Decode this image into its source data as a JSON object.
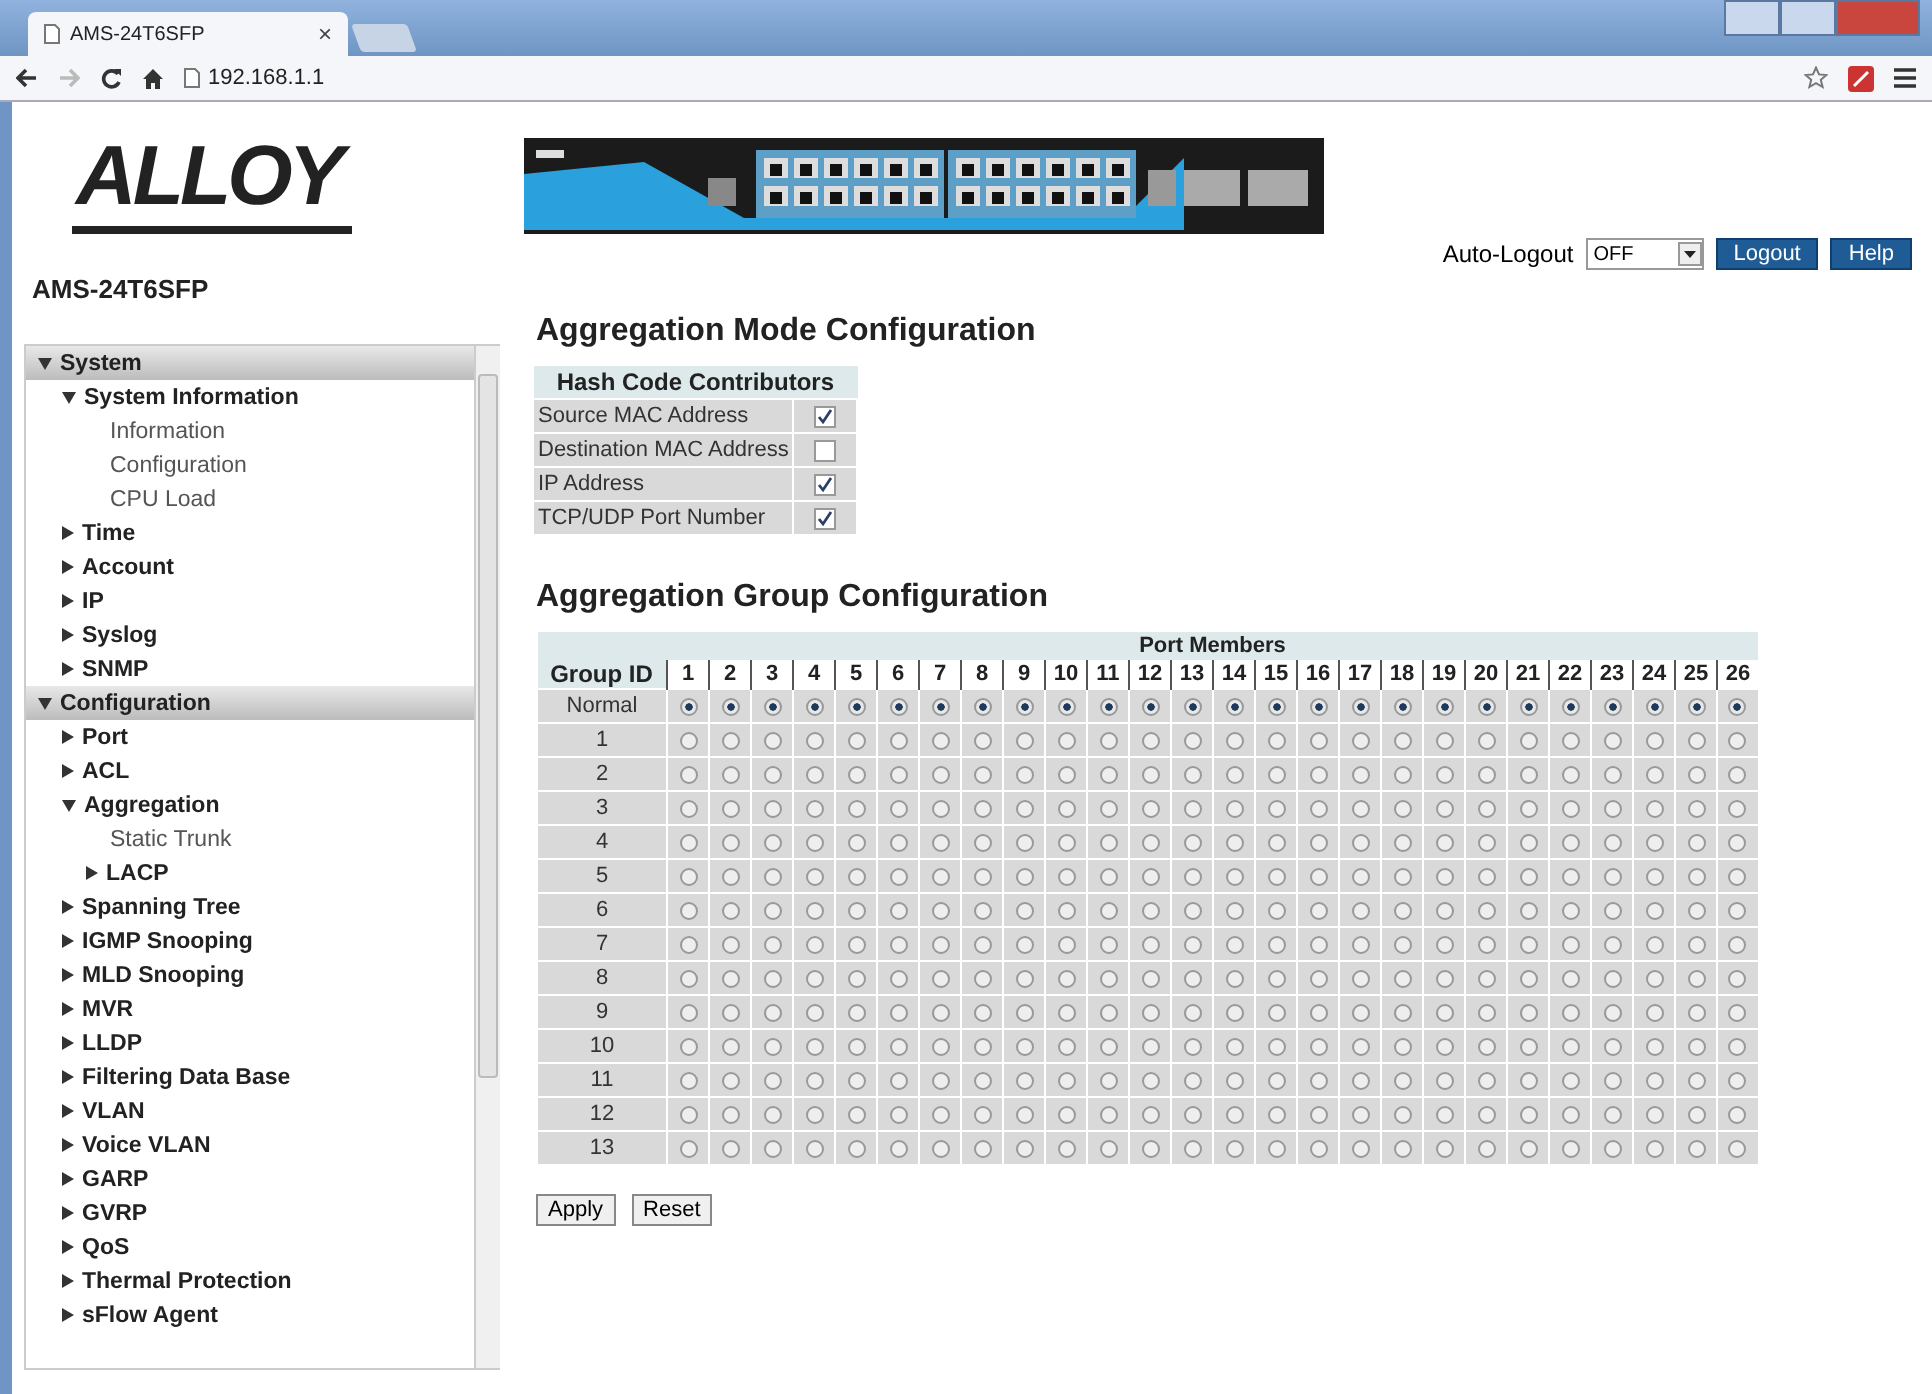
{
  "browser": {
    "tab_title": "AMS-24T6SFP",
    "tab_close": "×",
    "address": "192.168.1.1"
  },
  "brand": {
    "logo": "ALLOY",
    "model": "AMS-24T6SFP"
  },
  "sidebar": {
    "items": [
      {
        "label": "System",
        "kind": "folder",
        "expanded": true,
        "children": [
          {
            "label": "System Information",
            "kind": "folder",
            "expanded": true,
            "children": [
              {
                "label": "Information",
                "kind": "page"
              },
              {
                "label": "Configuration",
                "kind": "page"
              },
              {
                "label": "CPU Load",
                "kind": "page"
              }
            ]
          },
          {
            "label": "Time",
            "kind": "folder",
            "expanded": false
          },
          {
            "label": "Account",
            "kind": "folder",
            "expanded": false
          },
          {
            "label": "IP",
            "kind": "folder",
            "expanded": false
          },
          {
            "label": "Syslog",
            "kind": "folder",
            "expanded": false
          },
          {
            "label": "SNMP",
            "kind": "folder",
            "expanded": false
          }
        ]
      },
      {
        "label": "Configuration",
        "kind": "folder",
        "expanded": true,
        "children": [
          {
            "label": "Port",
            "kind": "folder",
            "expanded": false
          },
          {
            "label": "ACL",
            "kind": "folder",
            "expanded": false
          },
          {
            "label": "Aggregation",
            "kind": "folder",
            "expanded": true,
            "children": [
              {
                "label": "Static Trunk",
                "kind": "page"
              },
              {
                "label": "LACP",
                "kind": "folder",
                "expanded": false
              }
            ]
          },
          {
            "label": "Spanning Tree",
            "kind": "folder",
            "expanded": false
          },
          {
            "label": "IGMP Snooping",
            "kind": "folder",
            "expanded": false
          },
          {
            "label": "MLD Snooping",
            "kind": "folder",
            "expanded": false
          },
          {
            "label": "MVR",
            "kind": "folder",
            "expanded": false
          },
          {
            "label": "LLDP",
            "kind": "folder",
            "expanded": false
          },
          {
            "label": "Filtering Data Base",
            "kind": "folder",
            "expanded": false
          },
          {
            "label": "VLAN",
            "kind": "folder",
            "expanded": false
          },
          {
            "label": "Voice VLAN",
            "kind": "folder",
            "expanded": false
          },
          {
            "label": "GARP",
            "kind": "folder",
            "expanded": false
          },
          {
            "label": "GVRP",
            "kind": "folder",
            "expanded": false
          },
          {
            "label": "QoS",
            "kind": "folder",
            "expanded": false
          },
          {
            "label": "Thermal Protection",
            "kind": "folder",
            "expanded": false
          },
          {
            "label": "sFlow Agent",
            "kind": "folder",
            "expanded": false
          }
        ]
      }
    ]
  },
  "toolbar": {
    "auto_logout_label": "Auto-Logout",
    "auto_logout_value": "OFF",
    "buttons": [
      "Logout",
      "Help"
    ]
  },
  "mode": {
    "title": "Aggregation Mode Configuration",
    "table_header": "Hash Code Contributors",
    "rows": [
      {
        "label": "Source MAC Address",
        "checked": true
      },
      {
        "label": "Destination MAC Address",
        "checked": false
      },
      {
        "label": "IP Address",
        "checked": true
      },
      {
        "label": "TCP/UDP Port Number",
        "checked": true
      }
    ]
  },
  "groups": {
    "title": "Aggregation Group Configuration",
    "group_header": "Group ID",
    "members_header": "Port Members",
    "ports": [
      "1",
      "2",
      "3",
      "4",
      "5",
      "6",
      "7",
      "8",
      "9",
      "10",
      "11",
      "12",
      "13",
      "14",
      "15",
      "16",
      "17",
      "18",
      "19",
      "20",
      "21",
      "22",
      "23",
      "24",
      "25",
      "26"
    ],
    "rows": [
      {
        "group": "Normal",
        "selected": [
          true,
          true,
          true,
          true,
          true,
          true,
          true,
          true,
          true,
          true,
          true,
          true,
          true,
          true,
          true,
          true,
          true,
          true,
          true,
          true,
          true,
          true,
          true,
          true,
          true,
          true
        ]
      },
      {
        "group": "1",
        "selected": [
          false,
          false,
          false,
          false,
          false,
          false,
          false,
          false,
          false,
          false,
          false,
          false,
          false,
          false,
          false,
          false,
          false,
          false,
          false,
          false,
          false,
          false,
          false,
          false,
          false,
          false
        ]
      },
      {
        "group": "2",
        "selected": [
          false,
          false,
          false,
          false,
          false,
          false,
          false,
          false,
          false,
          false,
          false,
          false,
          false,
          false,
          false,
          false,
          false,
          false,
          false,
          false,
          false,
          false,
          false,
          false,
          false,
          false
        ]
      },
      {
        "group": "3",
        "selected": [
          false,
          false,
          false,
          false,
          false,
          false,
          false,
          false,
          false,
          false,
          false,
          false,
          false,
          false,
          false,
          false,
          false,
          false,
          false,
          false,
          false,
          false,
          false,
          false,
          false,
          false
        ]
      },
      {
        "group": "4",
        "selected": [
          false,
          false,
          false,
          false,
          false,
          false,
          false,
          false,
          false,
          false,
          false,
          false,
          false,
          false,
          false,
          false,
          false,
          false,
          false,
          false,
          false,
          false,
          false,
          false,
          false,
          false
        ]
      },
      {
        "group": "5",
        "selected": [
          false,
          false,
          false,
          false,
          false,
          false,
          false,
          false,
          false,
          false,
          false,
          false,
          false,
          false,
          false,
          false,
          false,
          false,
          false,
          false,
          false,
          false,
          false,
          false,
          false,
          false
        ]
      },
      {
        "group": "6",
        "selected": [
          false,
          false,
          false,
          false,
          false,
          false,
          false,
          false,
          false,
          false,
          false,
          false,
          false,
          false,
          false,
          false,
          false,
          false,
          false,
          false,
          false,
          false,
          false,
          false,
          false,
          false
        ]
      },
      {
        "group": "7",
        "selected": [
          false,
          false,
          false,
          false,
          false,
          false,
          false,
          false,
          false,
          false,
          false,
          false,
          false,
          false,
          false,
          false,
          false,
          false,
          false,
          false,
          false,
          false,
          false,
          false,
          false,
          false
        ]
      },
      {
        "group": "8",
        "selected": [
          false,
          false,
          false,
          false,
          false,
          false,
          false,
          false,
          false,
          false,
          false,
          false,
          false,
          false,
          false,
          false,
          false,
          false,
          false,
          false,
          false,
          false,
          false,
          false,
          false,
          false
        ]
      },
      {
        "group": "9",
        "selected": [
          false,
          false,
          false,
          false,
          false,
          false,
          false,
          false,
          false,
          false,
          false,
          false,
          false,
          false,
          false,
          false,
          false,
          false,
          false,
          false,
          false,
          false,
          false,
          false,
          false,
          false
        ]
      },
      {
        "group": "10",
        "selected": [
          false,
          false,
          false,
          false,
          false,
          false,
          false,
          false,
          false,
          false,
          false,
          false,
          false,
          false,
          false,
          false,
          false,
          false,
          false,
          false,
          false,
          false,
          false,
          false,
          false,
          false
        ]
      },
      {
        "group": "11",
        "selected": [
          false,
          false,
          false,
          false,
          false,
          false,
          false,
          false,
          false,
          false,
          false,
          false,
          false,
          false,
          false,
          false,
          false,
          false,
          false,
          false,
          false,
          false,
          false,
          false,
          false,
          false
        ]
      },
      {
        "group": "12",
        "selected": [
          false,
          false,
          false,
          false,
          false,
          false,
          false,
          false,
          false,
          false,
          false,
          false,
          false,
          false,
          false,
          false,
          false,
          false,
          false,
          false,
          false,
          false,
          false,
          false,
          false,
          false
        ]
      },
      {
        "group": "13",
        "selected": [
          false,
          false,
          false,
          false,
          false,
          false,
          false,
          false,
          false,
          false,
          false,
          false,
          false,
          false,
          false,
          false,
          false,
          false,
          false,
          false,
          false,
          false,
          false,
          false,
          false,
          false
        ]
      }
    ]
  },
  "actions": [
    "Apply",
    "Reset"
  ]
}
